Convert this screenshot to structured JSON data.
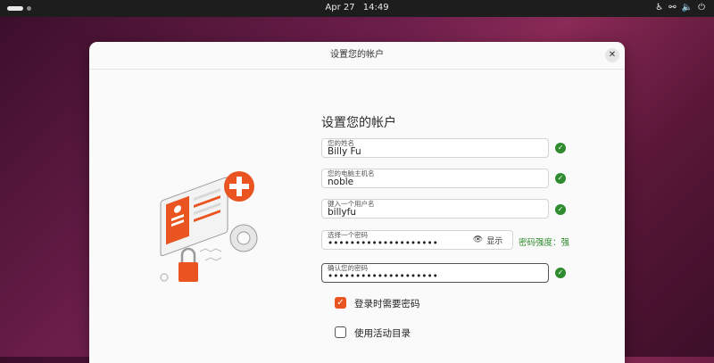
{
  "topbar": {
    "date": "Apr 27",
    "time": "14:49",
    "icons": [
      "accessibility-icon",
      "network-icon",
      "volume-icon",
      "power-icon"
    ]
  },
  "dialog": {
    "title": "设置您的帐户",
    "close_glyph": "✕",
    "heading": "设置您的帐户",
    "fields": {
      "name": {
        "label": "您的姓名",
        "value": "Billy Fu"
      },
      "hostname": {
        "label": "您的电脑主机名",
        "value": "noble"
      },
      "username": {
        "label": "键入一个用户名",
        "value": "billyfu"
      },
      "password": {
        "label": "选择一个密码",
        "value": "••••••••••••••••••••"
      },
      "confirm": {
        "label": "确认您的密码",
        "value": "••••••••••••••••••••"
      }
    },
    "show_button": "显示",
    "strength": "密码强度：强",
    "checkboxes": [
      {
        "label": "登录时需要密码",
        "checked": true
      },
      {
        "label": "使用活动目录",
        "checked": false
      }
    ]
  },
  "colors": {
    "accent": "#e95420",
    "success": "#2e8b2e"
  }
}
